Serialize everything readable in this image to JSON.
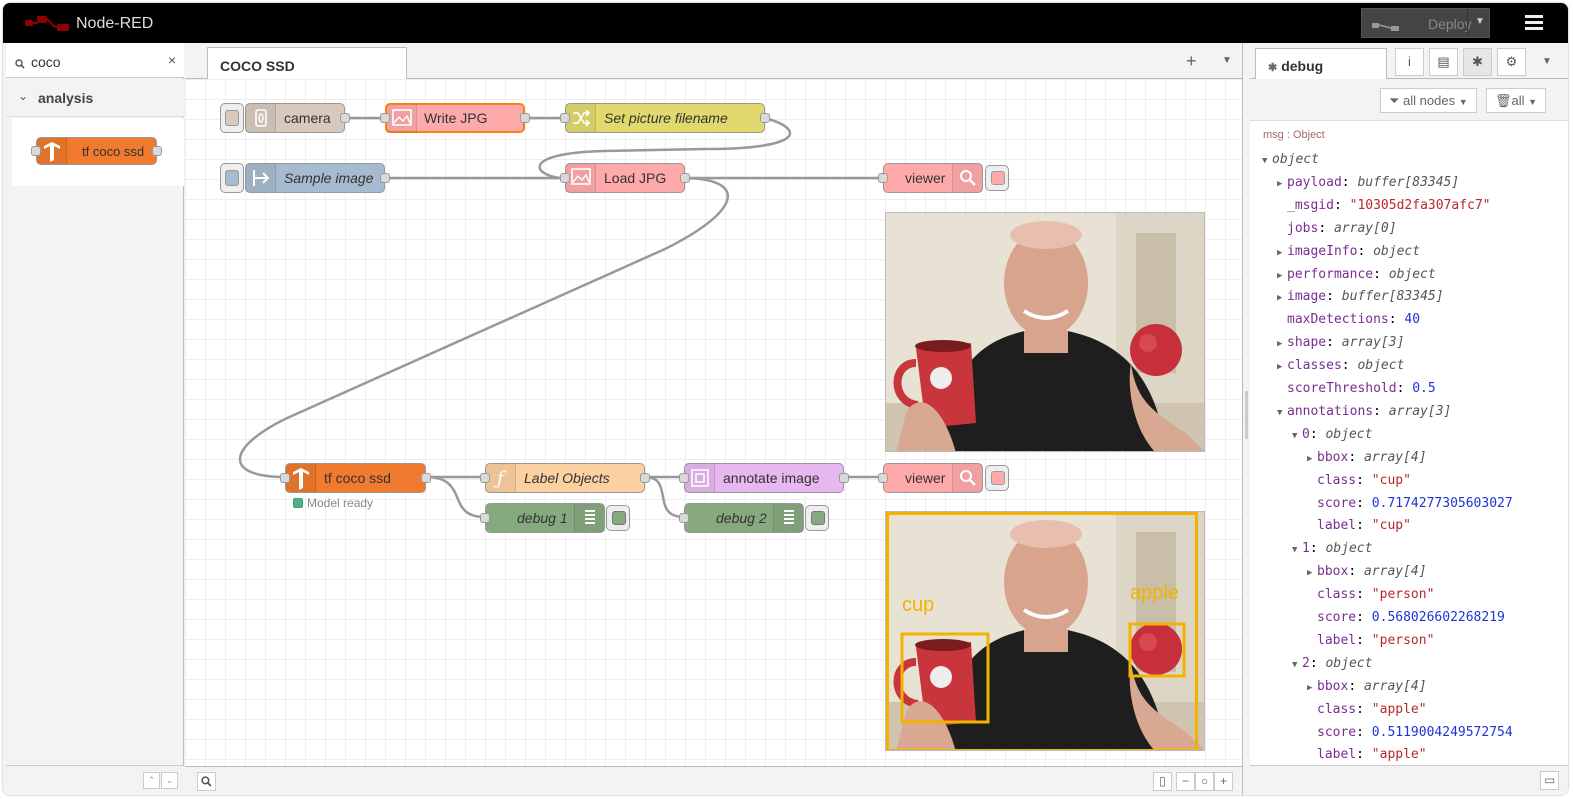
{
  "app": {
    "title": "Node-RED"
  },
  "header": {
    "deploy_label": "Deploy"
  },
  "palette": {
    "search_value": "coco",
    "clear_glyph": "×",
    "category_label": "analysis",
    "node_label": "tf coco ssd"
  },
  "workspace": {
    "tab_label": "COCO SSD",
    "add_glyph": "+",
    "nodes": {
      "camera": "camera",
      "write_jpg": "Write JPG",
      "set_filename": "Set picture filename",
      "sample_image": "Sample image",
      "load_jpg": "Load JPG",
      "viewer1": "viewer",
      "tf_coco_ssd": "tf coco ssd",
      "tf_status": "Model ready",
      "label_objects": "Label Objects",
      "annotate_image": "annotate image",
      "viewer2": "viewer",
      "debug1": "debug 1",
      "debug2": "debug 2"
    },
    "annotations": [
      {
        "label": "cup",
        "color": "#f2b200"
      },
      {
        "label": "apple",
        "color": "#f2b200"
      }
    ]
  },
  "sidebar": {
    "tab_label": "debug",
    "filter_nodes": "all nodes",
    "filter_all": "all",
    "msg_header": "msg : Object",
    "tree": [
      {
        "indent": 0,
        "toggle": "open",
        "key": "object",
        "value": "",
        "vtype": "t"
      },
      {
        "indent": 1,
        "toggle": "closed",
        "key": "payload",
        "value": "buffer[83345]",
        "vtype": "t"
      },
      {
        "indent": 1,
        "toggle": "none",
        "key": "_msgid",
        "value": "\"10305d2fa307afc7\"",
        "vtype": "s"
      },
      {
        "indent": 1,
        "toggle": "none",
        "key": "jobs",
        "value": "array[0]",
        "vtype": "t"
      },
      {
        "indent": 1,
        "toggle": "closed",
        "key": "imageInfo",
        "value": "object",
        "vtype": "t"
      },
      {
        "indent": 1,
        "toggle": "closed",
        "key": "performance",
        "value": "object",
        "vtype": "t"
      },
      {
        "indent": 1,
        "toggle": "closed",
        "key": "image",
        "value": "buffer[83345]",
        "vtype": "t"
      },
      {
        "indent": 1,
        "toggle": "none",
        "key": "maxDetections",
        "value": "40",
        "vtype": "n"
      },
      {
        "indent": 1,
        "toggle": "closed",
        "key": "shape",
        "value": "array[3]",
        "vtype": "t"
      },
      {
        "indent": 1,
        "toggle": "closed",
        "key": "classes",
        "value": "object",
        "vtype": "t"
      },
      {
        "indent": 1,
        "toggle": "none",
        "key": "scoreThreshold",
        "value": "0.5",
        "vtype": "n"
      },
      {
        "indent": 1,
        "toggle": "open",
        "key": "annotations",
        "value": "array[3]",
        "vtype": "t"
      },
      {
        "indent": 2,
        "toggle": "open",
        "key": "0",
        "value": "object",
        "vtype": "t"
      },
      {
        "indent": 3,
        "toggle": "closed",
        "key": "bbox",
        "value": "array[4]",
        "vtype": "t"
      },
      {
        "indent": 3,
        "toggle": "none",
        "key": "class",
        "value": "\"cup\"",
        "vtype": "s"
      },
      {
        "indent": 3,
        "toggle": "none",
        "key": "score",
        "value": "0.7174277305603027",
        "vtype": "n"
      },
      {
        "indent": 3,
        "toggle": "none",
        "key": "label",
        "value": "\"cup\"",
        "vtype": "s"
      },
      {
        "indent": 2,
        "toggle": "open",
        "key": "1",
        "value": "object",
        "vtype": "t"
      },
      {
        "indent": 3,
        "toggle": "closed",
        "key": "bbox",
        "value": "array[4]",
        "vtype": "t"
      },
      {
        "indent": 3,
        "toggle": "none",
        "key": "class",
        "value": "\"person\"",
        "vtype": "s"
      },
      {
        "indent": 3,
        "toggle": "none",
        "key": "score",
        "value": "0.568026602268219",
        "vtype": "n"
      },
      {
        "indent": 3,
        "toggle": "none",
        "key": "label",
        "value": "\"person\"",
        "vtype": "s"
      },
      {
        "indent": 2,
        "toggle": "open",
        "key": "2",
        "value": "object",
        "vtype": "t"
      },
      {
        "indent": 3,
        "toggle": "closed",
        "key": "bbox",
        "value": "array[4]",
        "vtype": "t"
      },
      {
        "indent": 3,
        "toggle": "none",
        "key": "class",
        "value": "\"apple\"",
        "vtype": "s"
      },
      {
        "indent": 3,
        "toggle": "none",
        "key": "score",
        "value": "0.5119004249572754",
        "vtype": "n"
      },
      {
        "indent": 3,
        "toggle": "none",
        "key": "label",
        "value": "\"apple\"",
        "vtype": "s"
      }
    ]
  },
  "colors": {
    "header_bg": "#000000",
    "camera_node": "#d7c9bd",
    "image_node": "#ffaaaa",
    "change_node": "#e2d96e",
    "inject_node": "#a6bbcf",
    "tf_node": "#f07a2d",
    "function_node": "#fdd0a2",
    "annotate_node": "#e7b8f0",
    "debug_node": "#87a980",
    "annotation_box": "#f2b200"
  }
}
